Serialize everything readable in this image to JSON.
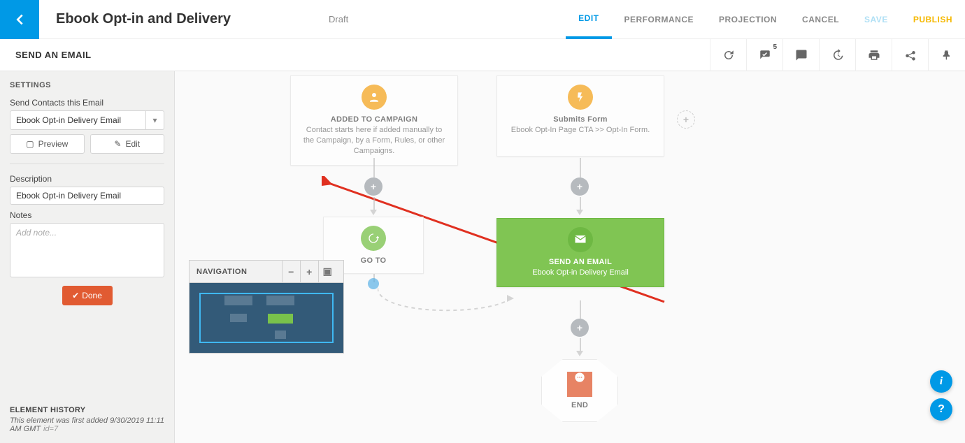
{
  "header": {
    "title": "Ebook Opt-in and Delivery",
    "status": "Draft",
    "tabs": {
      "edit": "EDIT",
      "performance": "PERFORMANCE",
      "projection": "PROJECTION",
      "cancel": "CANCEL",
      "save": "SAVE",
      "publish": "PUBLISH"
    },
    "toolbar_badge": "5"
  },
  "subheader": {
    "title": "SEND AN EMAIL"
  },
  "sidebar": {
    "settings_label": "SETTINGS",
    "field1_label": "Send Contacts this Email",
    "field1_value": "Ebook Opt-in Delivery Email",
    "preview_label": "Preview",
    "edit_label": "Edit",
    "description_label": "Description",
    "description_value": "Ebook Opt-in Delivery Email",
    "notes_label": "Notes",
    "notes_placeholder": "Add note...",
    "done_label": "Done",
    "history_label": "ELEMENT HISTORY",
    "history_text": "This element was first added 9/30/2019 11:11 AM GMT",
    "history_id": "id=7"
  },
  "canvas": {
    "added": {
      "title": "ADDED TO CAMPAIGN",
      "sub": "Contact starts here if added manually to the Campaign, by a Form, Rules, or other Campaigns."
    },
    "submits": {
      "title": "Submits Form",
      "sub": "Ebook Opt-In Page CTA >> Opt-In Form."
    },
    "goto": {
      "title": "GO TO"
    },
    "send": {
      "title": "SEND AN EMAIL",
      "sub": "Ebook Opt-in Delivery Email"
    },
    "end": {
      "title": "END"
    },
    "nav_label": "NAVIGATION"
  }
}
